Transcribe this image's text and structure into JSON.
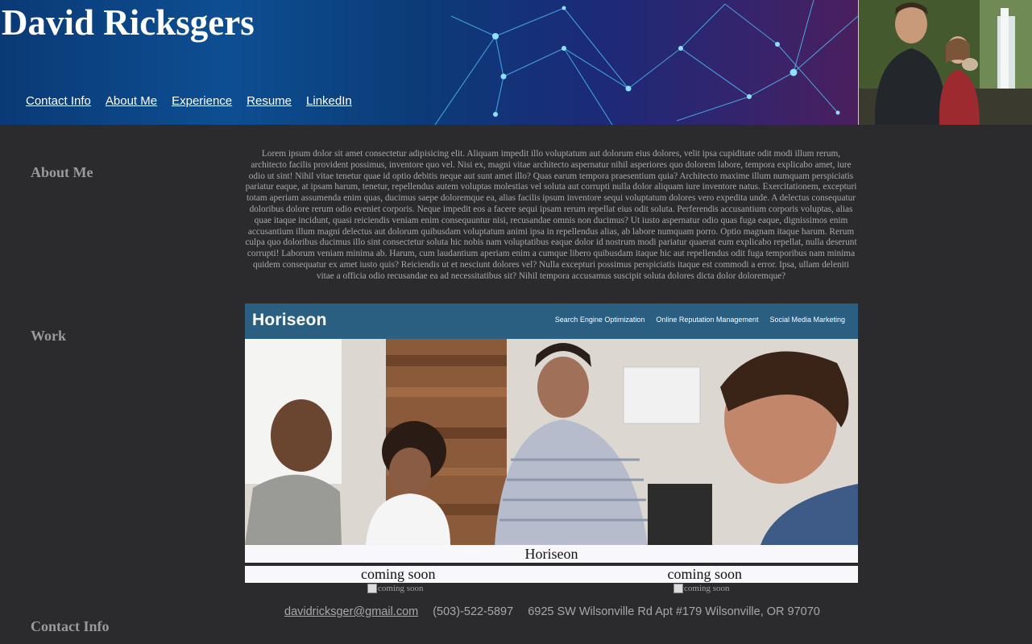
{
  "header": {
    "title": "David Ricksgers",
    "nav": [
      {
        "label": "Contact Info"
      },
      {
        "label": "About Me"
      },
      {
        "label": "Experience"
      },
      {
        "label": "Resume"
      },
      {
        "label": "LinkedIn"
      }
    ]
  },
  "sections": {
    "about_heading": "About Me",
    "work_heading": "Work",
    "contact_heading": "Contact Info"
  },
  "about": {
    "text": "Lorem ipsum dolor sit amet consectetur adipisicing elit. Aliquam impedit illo voluptatum aut dolorum eius dolores, velit ipsa cupiditate odit modi illum rerum, architecto facilis provident possimus, inventore quo vel. Nisi ex, magni vitae architecto aspernatur nihil asperiores quo dolorem labore, tempora explicabo amet, iure odio ut sint! Nihil vitae tenetur quae id optio debitis neque aut sunt amet illo? Quas earum tempora praesentium quia? Architecto maxime illum numquam perspiciatis pariatur eaque, at ipsam harum, tenetur, repellendus autem voluptas molestias vel soluta aut corrupti nulla dolor aliquam iure inventore natus. Exercitationem, excepturi totam aperiam assumenda enim quas, ducimus saepe doloremque ea, alias facilis ipsum inventore sequi voluptatum dolores vero expedita unde. A delectus consequatur doloribus dolore rerum odio eveniet corporis. Neque impedit eos a facere sequi ipsam rerum repellat eius odit soluta. Perferendis accusantium corporis voluptas, alias quae itaque incidunt, quasi reiciendis veniam enim consequuntur nisi, recusandae omnis non ducimus? Ut iusto aspernatur odio quas fuga eaque, dignissimos enim accusantium illum magni delectus aut dolorum quibusdam voluptatum animi ipsa in repellendus alias, ab labore numquam porro. Optio magnam itaque harum. Rerum culpa quo doloribus ducimus illo sint consectetur soluta hic nobis nam voluptatibus eaque dolor id nostrum modi pariatur quaerat eum explicabo repellat, nulla deserunt corrupti! Laborum veniam minima ab. Harum, cum laudantium aperiam enim a cumque libero quibusdam itaque hic aut repellendus odit fuga temporibus nam minima quidem consequatur ex amet iusto quis? Reiciendis ut et nesciunt dolores vel? Nulla excepturi possimus perspiciatis itaque est commodi a error. Ipsa, ullam deleniti vitae a officia odio recusandae ea ad necessitatibus sit? Nihil tempora accusamus suscipit soluta dolores dicta dolor doloremque?"
  },
  "work": {
    "screenshot": {
      "logo": "Horiseon",
      "links": [
        "Search Engine Optimization",
        "Online Reputation Management",
        "Social Media Marketing"
      ]
    },
    "caption": "Horiseon",
    "coming_soon": [
      {
        "label": "coming soon",
        "alt": "coming soon"
      },
      {
        "label": "coming soon",
        "alt": "coming soon"
      }
    ]
  },
  "contact": {
    "email": "davidricksger@gmail.com",
    "phone": "(503)-522-5897",
    "address": "6925 SW Wilsonville Rd Apt #179 Wilsonville, OR 97070"
  },
  "colors": {
    "background": "#2b2b2e",
    "header_blue": "#0d4e92",
    "horiseon_nav": "#2b5f81",
    "heading_gray": "#9a9a9a"
  }
}
